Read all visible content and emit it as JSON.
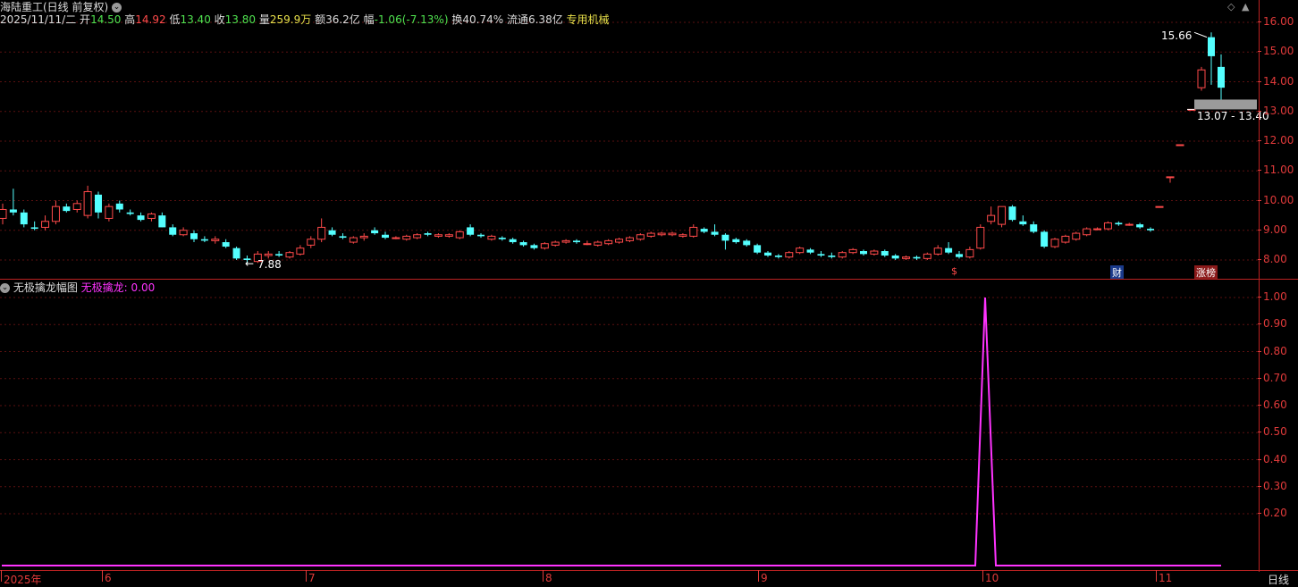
{
  "header": {
    "title": "海陆重工(日线 前复权)",
    "date": "2025/11/11/二",
    "open_label": "开",
    "open": "14.50",
    "high_label": "高",
    "high": "14.92",
    "low_label": "低",
    "low": "13.40",
    "close_label": "收",
    "close": "13.80",
    "vol_label": "量",
    "vol": "259.9万",
    "amount_label": "额",
    "amount": "36.2亿",
    "chg_label": "幅",
    "chg": "-1.06(-7.13%)",
    "turnover_label": "换",
    "turnover": "40.74%",
    "float_label": "流通",
    "float": "6.38亿",
    "industry": "专用机械"
  },
  "indicator": {
    "name": "无极擒龙幅图",
    "series_label": "无极擒龙:",
    "value": "0.00"
  },
  "main_axis": [
    "16.00",
    "15.00",
    "14.00",
    "13.00",
    "12.00",
    "11.00",
    "10.00",
    "9.00",
    "8.00"
  ],
  "ind_axis": [
    "1.00",
    "0.90",
    "0.80",
    "0.70",
    "0.60",
    "0.50",
    "0.40",
    "0.30",
    "0.20"
  ],
  "x_axis": [
    "2025年",
    "6",
    "7",
    "8",
    "9",
    "10",
    "11"
  ],
  "period_label": "日线",
  "annotations": {
    "high_mark": "15.66",
    "low_mark": "7.88",
    "gap_range": "13.07 - 13.40",
    "badge_s": "$",
    "badge_cai": "财",
    "badge_zhang": "涨榜"
  },
  "colors": {
    "up": "#ff4a4a",
    "down": "#54ffff",
    "grid": "#5a1010",
    "axis": "#e03a3a",
    "indicator_line": "#ff33ff",
    "industry": "#e8e04a"
  },
  "chart_data": [
    {
      "type": "candlestick",
      "title": "海陆重工(日线 前复权)",
      "ylim": [
        7.6,
        16.6
      ],
      "candles": [
        {
          "o": 9.4,
          "h": 9.9,
          "l": 9.2,
          "c": 9.7
        },
        {
          "o": 9.7,
          "h": 10.4,
          "l": 9.5,
          "c": 9.6
        },
        {
          "o": 9.6,
          "h": 9.7,
          "l": 9.1,
          "c": 9.2
        },
        {
          "o": 9.1,
          "h": 9.3,
          "l": 9.0,
          "c": 9.05
        },
        {
          "o": 9.1,
          "h": 9.5,
          "l": 9.0,
          "c": 9.3
        },
        {
          "o": 9.3,
          "h": 10.0,
          "l": 9.2,
          "c": 9.8
        },
        {
          "o": 9.8,
          "h": 9.9,
          "l": 9.6,
          "c": 9.65
        },
        {
          "o": 9.7,
          "h": 10.0,
          "l": 9.6,
          "c": 9.9
        },
        {
          "o": 9.5,
          "h": 10.5,
          "l": 9.4,
          "c": 10.3
        },
        {
          "o": 10.2,
          "h": 10.3,
          "l": 9.4,
          "c": 9.6
        },
        {
          "o": 9.4,
          "h": 9.9,
          "l": 9.3,
          "c": 9.8
        },
        {
          "o": 9.9,
          "h": 10.0,
          "l": 9.6,
          "c": 9.7
        },
        {
          "o": 9.6,
          "h": 9.7,
          "l": 9.5,
          "c": 9.55
        },
        {
          "o": 9.5,
          "h": 9.6,
          "l": 9.3,
          "c": 9.35
        },
        {
          "o": 9.4,
          "h": 9.6,
          "l": 9.3,
          "c": 9.55
        },
        {
          "o": 9.5,
          "h": 9.6,
          "l": 9.1,
          "c": 9.1
        },
        {
          "o": 9.1,
          "h": 9.2,
          "l": 8.8,
          "c": 8.85
        },
        {
          "o": 8.85,
          "h": 9.1,
          "l": 8.8,
          "c": 9.0
        },
        {
          "o": 8.9,
          "h": 9.0,
          "l": 8.6,
          "c": 8.7
        },
        {
          "o": 8.7,
          "h": 8.8,
          "l": 8.6,
          "c": 8.65
        },
        {
          "o": 8.65,
          "h": 8.8,
          "l": 8.55,
          "c": 8.7
        },
        {
          "o": 8.6,
          "h": 8.7,
          "l": 8.4,
          "c": 8.45
        },
        {
          "o": 8.4,
          "h": 8.45,
          "l": 8.0,
          "c": 8.05
        },
        {
          "o": 8.05,
          "h": 8.15,
          "l": 7.88,
          "c": 8.0
        },
        {
          "o": 7.95,
          "h": 8.3,
          "l": 7.9,
          "c": 8.2
        },
        {
          "o": 8.15,
          "h": 8.3,
          "l": 8.05,
          "c": 8.2
        },
        {
          "o": 8.2,
          "h": 8.3,
          "l": 8.1,
          "c": 8.15
        },
        {
          "o": 8.1,
          "h": 8.3,
          "l": 8.05,
          "c": 8.25
        },
        {
          "o": 8.2,
          "h": 8.5,
          "l": 8.15,
          "c": 8.4
        },
        {
          "o": 8.5,
          "h": 8.8,
          "l": 8.4,
          "c": 8.7
        },
        {
          "o": 8.7,
          "h": 9.4,
          "l": 8.6,
          "c": 9.1
        },
        {
          "o": 9.0,
          "h": 9.1,
          "l": 8.8,
          "c": 8.85
        },
        {
          "o": 8.8,
          "h": 8.9,
          "l": 8.7,
          "c": 8.75
        },
        {
          "o": 8.6,
          "h": 8.8,
          "l": 8.55,
          "c": 8.75
        },
        {
          "o": 8.75,
          "h": 8.9,
          "l": 8.65,
          "c": 8.8
        },
        {
          "o": 9.0,
          "h": 9.1,
          "l": 8.85,
          "c": 8.9
        },
        {
          "o": 8.85,
          "h": 8.95,
          "l": 8.7,
          "c": 8.75
        },
        {
          "o": 8.75,
          "h": 8.8,
          "l": 8.7,
          "c": 8.75
        },
        {
          "o": 8.7,
          "h": 8.85,
          "l": 8.65,
          "c": 8.8
        },
        {
          "o": 8.75,
          "h": 8.9,
          "l": 8.7,
          "c": 8.85
        },
        {
          "o": 8.9,
          "h": 8.95,
          "l": 8.8,
          "c": 8.85
        },
        {
          "o": 8.8,
          "h": 8.9,
          "l": 8.75,
          "c": 8.85
        },
        {
          "o": 8.8,
          "h": 8.9,
          "l": 8.75,
          "c": 8.85
        },
        {
          "o": 8.75,
          "h": 9.0,
          "l": 8.7,
          "c": 8.95
        },
        {
          "o": 9.1,
          "h": 9.2,
          "l": 8.8,
          "c": 8.85
        },
        {
          "o": 8.85,
          "h": 8.9,
          "l": 8.75,
          "c": 8.8
        },
        {
          "o": 8.7,
          "h": 8.85,
          "l": 8.65,
          "c": 8.8
        },
        {
          "o": 8.75,
          "h": 8.8,
          "l": 8.65,
          "c": 8.7
        },
        {
          "o": 8.7,
          "h": 8.75,
          "l": 8.55,
          "c": 8.6
        },
        {
          "o": 8.6,
          "h": 8.65,
          "l": 8.45,
          "c": 8.5
        },
        {
          "o": 8.5,
          "h": 8.55,
          "l": 8.35,
          "c": 8.4
        },
        {
          "o": 8.4,
          "h": 8.6,
          "l": 8.35,
          "c": 8.55
        },
        {
          "o": 8.5,
          "h": 8.65,
          "l": 8.45,
          "c": 8.6
        },
        {
          "o": 8.6,
          "h": 8.7,
          "l": 8.55,
          "c": 8.65
        },
        {
          "o": 8.65,
          "h": 8.7,
          "l": 8.55,
          "c": 8.6
        },
        {
          "o": 8.55,
          "h": 8.65,
          "l": 8.5,
          "c": 8.55
        },
        {
          "o": 8.5,
          "h": 8.65,
          "l": 8.45,
          "c": 8.6
        },
        {
          "o": 8.55,
          "h": 8.7,
          "l": 8.5,
          "c": 8.65
        },
        {
          "o": 8.6,
          "h": 8.75,
          "l": 8.55,
          "c": 8.7
        },
        {
          "o": 8.65,
          "h": 8.8,
          "l": 8.6,
          "c": 8.75
        },
        {
          "o": 8.7,
          "h": 8.9,
          "l": 8.65,
          "c": 8.85
        },
        {
          "o": 8.8,
          "h": 8.95,
          "l": 8.75,
          "c": 8.9
        },
        {
          "o": 8.85,
          "h": 8.95,
          "l": 8.8,
          "c": 8.9
        },
        {
          "o": 8.85,
          "h": 8.95,
          "l": 8.8,
          "c": 8.9
        },
        {
          "o": 8.8,
          "h": 8.9,
          "l": 8.75,
          "c": 8.85
        },
        {
          "o": 8.8,
          "h": 9.2,
          "l": 8.75,
          "c": 9.1
        },
        {
          "o": 9.05,
          "h": 9.1,
          "l": 8.9,
          "c": 8.95
        },
        {
          "o": 8.95,
          "h": 9.2,
          "l": 8.8,
          "c": 8.85
        },
        {
          "o": 8.85,
          "h": 8.9,
          "l": 8.35,
          "c": 8.65
        },
        {
          "o": 8.7,
          "h": 8.75,
          "l": 8.55,
          "c": 8.6
        },
        {
          "o": 8.65,
          "h": 8.7,
          "l": 8.45,
          "c": 8.5
        },
        {
          "o": 8.5,
          "h": 8.55,
          "l": 8.2,
          "c": 8.25
        },
        {
          "o": 8.25,
          "h": 8.3,
          "l": 8.1,
          "c": 8.15
        },
        {
          "o": 8.15,
          "h": 8.2,
          "l": 8.05,
          "c": 8.1
        },
        {
          "o": 8.1,
          "h": 8.3,
          "l": 8.05,
          "c": 8.25
        },
        {
          "o": 8.25,
          "h": 8.45,
          "l": 8.2,
          "c": 8.4
        },
        {
          "o": 8.35,
          "h": 8.4,
          "l": 8.2,
          "c": 8.25
        },
        {
          "o": 8.2,
          "h": 8.3,
          "l": 8.1,
          "c": 8.15
        },
        {
          "o": 8.15,
          "h": 8.25,
          "l": 8.05,
          "c": 8.1
        },
        {
          "o": 8.1,
          "h": 8.3,
          "l": 8.05,
          "c": 8.25
        },
        {
          "o": 8.25,
          "h": 8.4,
          "l": 8.2,
          "c": 8.35
        },
        {
          "o": 8.3,
          "h": 8.35,
          "l": 8.15,
          "c": 8.2
        },
        {
          "o": 8.2,
          "h": 8.35,
          "l": 8.15,
          "c": 8.3
        },
        {
          "o": 8.3,
          "h": 8.35,
          "l": 8.1,
          "c": 8.15
        },
        {
          "o": 8.15,
          "h": 8.2,
          "l": 8.0,
          "c": 8.05
        },
        {
          "o": 8.05,
          "h": 8.15,
          "l": 8.0,
          "c": 8.1
        },
        {
          "o": 8.1,
          "h": 8.15,
          "l": 8.0,
          "c": 8.05
        },
        {
          "o": 8.05,
          "h": 8.25,
          "l": 8.0,
          "c": 8.2
        },
        {
          "o": 8.2,
          "h": 8.5,
          "l": 8.15,
          "c": 8.4
        },
        {
          "o": 8.4,
          "h": 8.6,
          "l": 8.2,
          "c": 8.25
        },
        {
          "o": 8.2,
          "h": 8.3,
          "l": 8.05,
          "c": 8.1
        },
        {
          "o": 8.1,
          "h": 8.45,
          "l": 8.05,
          "c": 8.35
        },
        {
          "o": 8.4,
          "h": 9.2,
          "l": 8.35,
          "c": 9.1
        },
        {
          "o": 9.3,
          "h": 9.8,
          "l": 9.2,
          "c": 9.5
        },
        {
          "o": 9.2,
          "h": 9.8,
          "l": 9.1,
          "c": 9.8
        },
        {
          "o": 9.8,
          "h": 9.85,
          "l": 9.3,
          "c": 9.35
        },
        {
          "o": 9.3,
          "h": 9.5,
          "l": 9.15,
          "c": 9.2
        },
        {
          "o": 9.2,
          "h": 9.3,
          "l": 8.9,
          "c": 8.95
        },
        {
          "o": 8.95,
          "h": 9.0,
          "l": 8.4,
          "c": 8.45
        },
        {
          "o": 8.45,
          "h": 8.75,
          "l": 8.4,
          "c": 8.7
        },
        {
          "o": 8.6,
          "h": 8.85,
          "l": 8.55,
          "c": 8.8
        },
        {
          "o": 8.7,
          "h": 8.95,
          "l": 8.65,
          "c": 8.9
        },
        {
          "o": 8.85,
          "h": 9.1,
          "l": 8.8,
          "c": 9.05
        },
        {
          "o": 9.05,
          "h": 9.1,
          "l": 9.0,
          "c": 9.05
        },
        {
          "o": 9.05,
          "h": 9.3,
          "l": 9.0,
          "c": 9.25
        },
        {
          "o": 9.25,
          "h": 9.3,
          "l": 9.15,
          "c": 9.2
        },
        {
          "o": 9.2,
          "h": 9.25,
          "l": 9.15,
          "c": 9.2
        },
        {
          "o": 9.2,
          "h": 9.25,
          "l": 9.05,
          "c": 9.1
        },
        {
          "o": 9.05,
          "h": 9.1,
          "l": 8.95,
          "c": 9.0
        },
        {
          "o": 9.8,
          "h": 9.8,
          "l": 9.8,
          "c": 9.8
        },
        {
          "o": 10.8,
          "h": 10.8,
          "l": 10.6,
          "c": 10.8
        },
        {
          "o": 11.88,
          "h": 11.88,
          "l": 11.88,
          "c": 11.88
        },
        {
          "o": 13.07,
          "h": 13.07,
          "l": 13.07,
          "c": 13.07
        },
        {
          "o": 13.8,
          "h": 14.5,
          "l": 13.7,
          "c": 14.4
        },
        {
          "o": 15.5,
          "h": 15.66,
          "l": 13.9,
          "c": 14.86
        },
        {
          "o": 14.5,
          "h": 14.92,
          "l": 13.4,
          "c": 13.8
        }
      ]
    },
    {
      "type": "line",
      "title": "无极擒龙幅图",
      "series": [
        {
          "name": "无极擒龙",
          "spike_index": 99,
          "spike_value": 1.0,
          "values_baseline": 0.0
        }
      ],
      "ylim": [
        0,
        1.05
      ]
    }
  ]
}
